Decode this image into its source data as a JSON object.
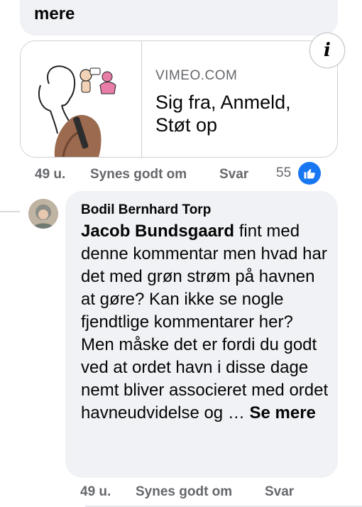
{
  "prev_comment": {
    "see_more": "mere"
  },
  "link_preview": {
    "domain": "VIMEO.COM",
    "title_line1": "Sig fra, Anmeld,",
    "title_line2": "Støt op",
    "info_icon": "info-icon"
  },
  "prev_meta": {
    "time": "49 u.",
    "like": "Synes godt om",
    "reply": "Svar",
    "reaction_count": "55",
    "reaction_icon": "thumbs-up-icon"
  },
  "comment": {
    "author": "Bodil Bernhard Torp",
    "mention": "Jacob Bundsgaard",
    "text": " fint med denne kommentar men hvad har det med grøn strøm på havnen at gøre? Kan ikke se nogle fjendtlige kommentarer her? Men måske det er fordi du godt ved at ordet havn i disse dage nemt bliver associeret med ordet havneudvidelse og … ",
    "see_more": "Se mere"
  },
  "comment_meta": {
    "time": "49 u.",
    "like": "Synes godt om",
    "reply": "Svar"
  },
  "colors": {
    "bubble": "#f0f2f5",
    "secondary_text": "#65676b",
    "like_blue": "#1877f2"
  }
}
